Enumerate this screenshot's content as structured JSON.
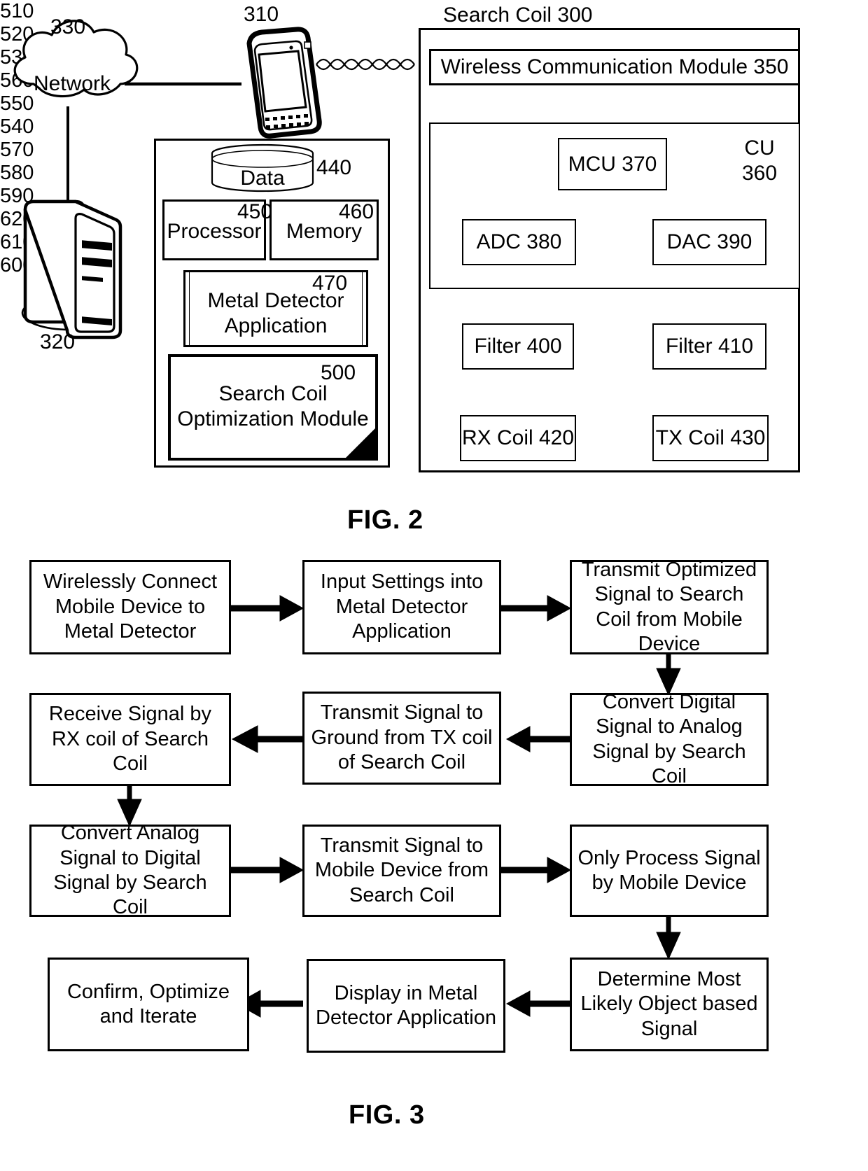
{
  "figures": [
    {
      "id": "fig2",
      "label": "FIG. 2"
    },
    {
      "id": "fig3",
      "label": "FIG. 3"
    }
  ],
  "fig2": {
    "caption": "FIG. 2",
    "network": {
      "label": "Network",
      "ref": "330"
    },
    "server": {
      "ref": "320"
    },
    "mobile_device": {
      "ref": "310"
    },
    "mobile_panel": {
      "data_store": {
        "label": "Data",
        "ref": "440"
      },
      "processor": {
        "label": "Processor",
        "ref": "450"
      },
      "memory": {
        "label": "Memory",
        "ref": "460"
      },
      "metal_detector_application": {
        "label": "Metal Detector Application",
        "ref": "470"
      },
      "search_coil_optimization_module": {
        "label": "Search Coil Optimization Module",
        "ref": "500"
      }
    },
    "search_coil": {
      "title": "Search Coil 300",
      "wireless_communication_module": "Wireless Communication Module 350",
      "cu_label_line1": "CU",
      "cu_label_line2": "360",
      "mcu": "MCU 370",
      "adc": "ADC 380",
      "dac": "DAC 390",
      "filter_rx": "Filter 400",
      "filter_tx": "Filter 410",
      "rx_coil": "RX Coil 420",
      "tx_coil": "TX Coil 430"
    }
  },
  "fig3": {
    "caption": "FIG. 3",
    "steps": [
      {
        "ref": "510",
        "text": "Wirelessly Connect Mobile Device to Metal Detector"
      },
      {
        "ref": "520",
        "text": "Input Settings into Metal Detector Application"
      },
      {
        "ref": "530",
        "text": "Transmit Optimized Signal to Search Coil from Mobile Device"
      },
      {
        "ref": "540",
        "text": "Convert Digital Signal to Analog Signal by Search Coil"
      },
      {
        "ref": "550",
        "text": "Transmit Signal to Ground from TX coil of Search Coil"
      },
      {
        "ref": "560",
        "text": "Receive Signal by RX coil of Search Coil"
      },
      {
        "ref": "570",
        "text": "Convert Analog Signal to Digital Signal by Search Coil"
      },
      {
        "ref": "580",
        "text": "Transmit  Signal to Mobile Device from Search Coil"
      },
      {
        "ref": "590",
        "text": "Only Process Signal by Mobile Device"
      },
      {
        "ref": "600",
        "text": "Determine Most Likely Object based Signal"
      },
      {
        "ref": "610",
        "text": "Display in Metal Detector Application"
      },
      {
        "ref": "620",
        "text": "Confirm, Optimize and Iterate"
      }
    ]
  },
  "colors": {
    "stroke": "#000000",
    "background": "#ffffff"
  }
}
